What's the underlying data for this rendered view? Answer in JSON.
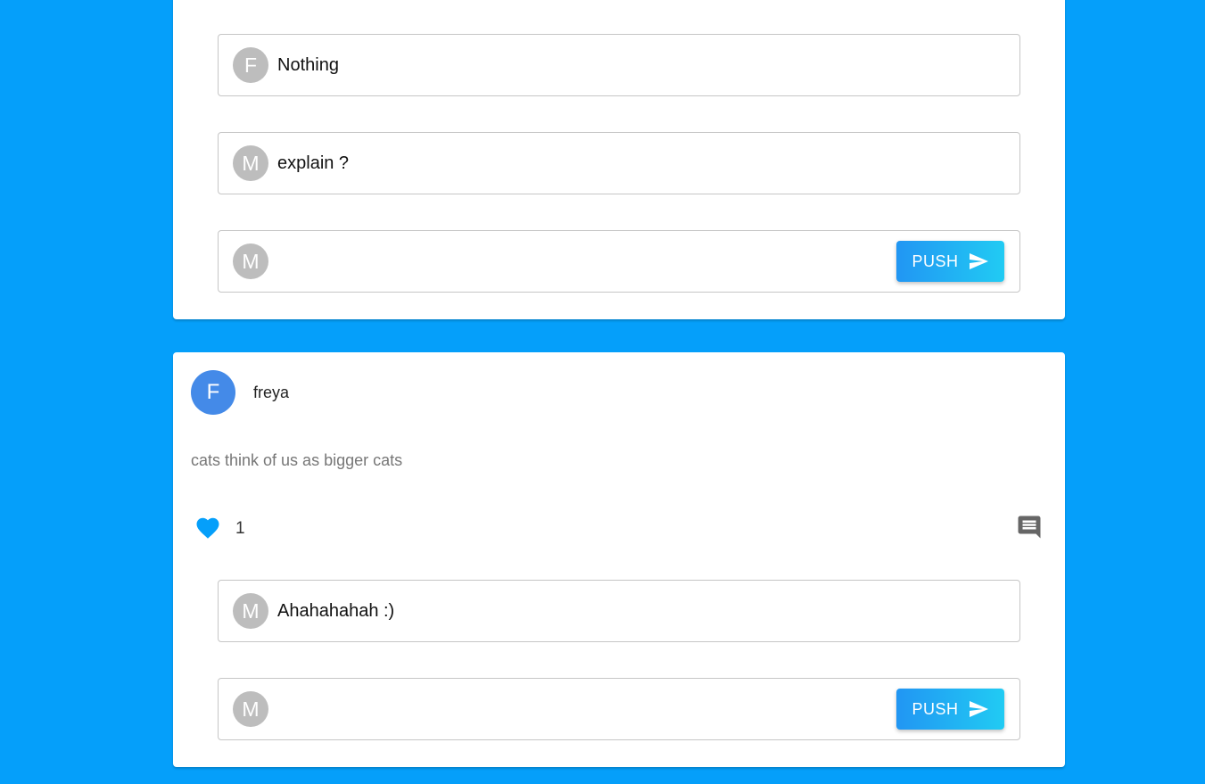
{
  "posts": [
    {
      "comments": [
        {
          "avatar_initial": "F",
          "text": "Nothing"
        },
        {
          "avatar_initial": "M",
          "text": "explain ?"
        }
      ],
      "new_comment": {
        "avatar_initial": "M",
        "value": "",
        "push_label": "PUSH"
      }
    },
    {
      "author": {
        "avatar_initial": "F",
        "name": "freya"
      },
      "body": "cats think of us as bigger cats",
      "likes": "1",
      "like_icon": "heart-icon",
      "comment_icon": "comment-icon",
      "comments": [
        {
          "avatar_initial": "M",
          "text": "Ahahahahah :)"
        }
      ],
      "new_comment": {
        "avatar_initial": "M",
        "value": "",
        "push_label": "PUSH"
      }
    }
  ],
  "colors": {
    "background": "#059ffa",
    "like": "#059ffa",
    "author_avatar": "#448ae8",
    "comment_avatar": "#bdbdbd",
    "push_gradient_start": "#2196f3",
    "push_gradient_end": "#21cbf3"
  }
}
